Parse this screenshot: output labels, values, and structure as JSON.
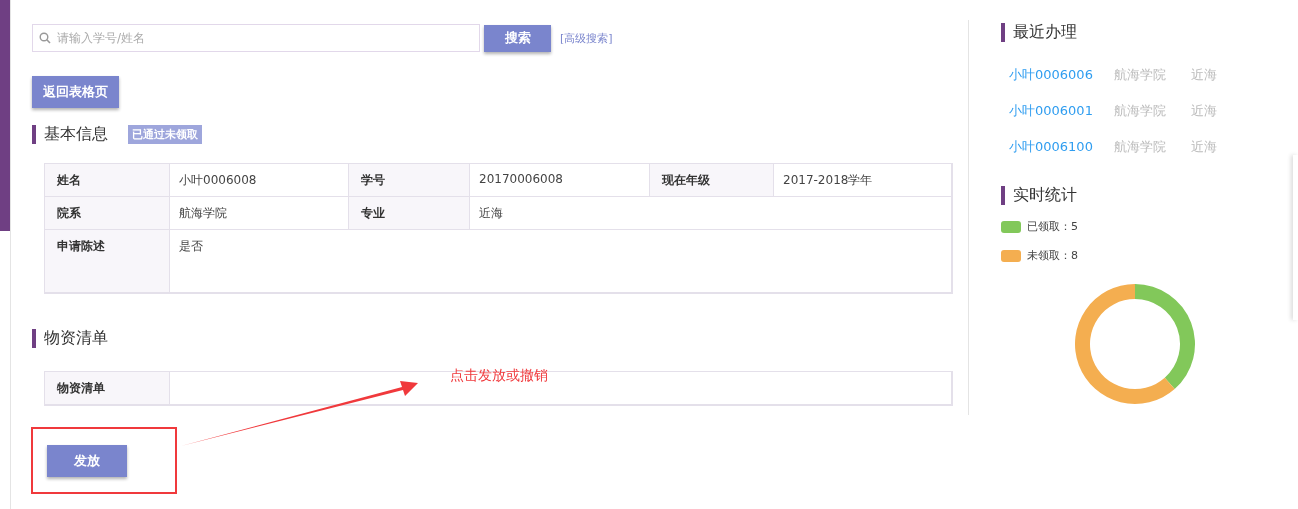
{
  "search": {
    "placeholder": "请输入学号/姓名",
    "button": "搜索",
    "advanced_link": "[高级搜索]"
  },
  "back_button": "返回表格页",
  "basic_info": {
    "title": "基本信息",
    "status_badge": "已通过未领取",
    "rows": [
      [
        {
          "label": "姓名",
          "value": "小叶0006008"
        },
        {
          "label": "学号",
          "value": "20170006008"
        },
        {
          "label": "现在年级",
          "value": "2017-2018学年"
        }
      ],
      [
        {
          "label": "院系",
          "value": "航海学院"
        },
        {
          "label": "专业",
          "value": "近海"
        }
      ],
      [
        {
          "label": "申请陈述",
          "value": "是否"
        }
      ]
    ]
  },
  "supplies": {
    "title": "物资清单",
    "label": "物资清单"
  },
  "issue_button": "发放",
  "annotation": {
    "text": "点击发放或撤销"
  },
  "recent": {
    "title": "最近办理",
    "items": [
      {
        "name": "小叶0006006",
        "college": "航海学院",
        "major": "近海"
      },
      {
        "name": "小叶0006001",
        "college": "航海学院",
        "major": "近海"
      },
      {
        "name": "小叶0006100",
        "college": "航海学院",
        "major": "近海"
      }
    ]
  },
  "stats": {
    "title": "实时统计",
    "legend": [
      {
        "label": "已领取：5",
        "color": "#82c85a"
      },
      {
        "label": "未领取：8",
        "color": "#f4ae50"
      }
    ],
    "chart_data": {
      "type": "donut",
      "values": [
        38.5,
        61.5
      ]
    }
  }
}
